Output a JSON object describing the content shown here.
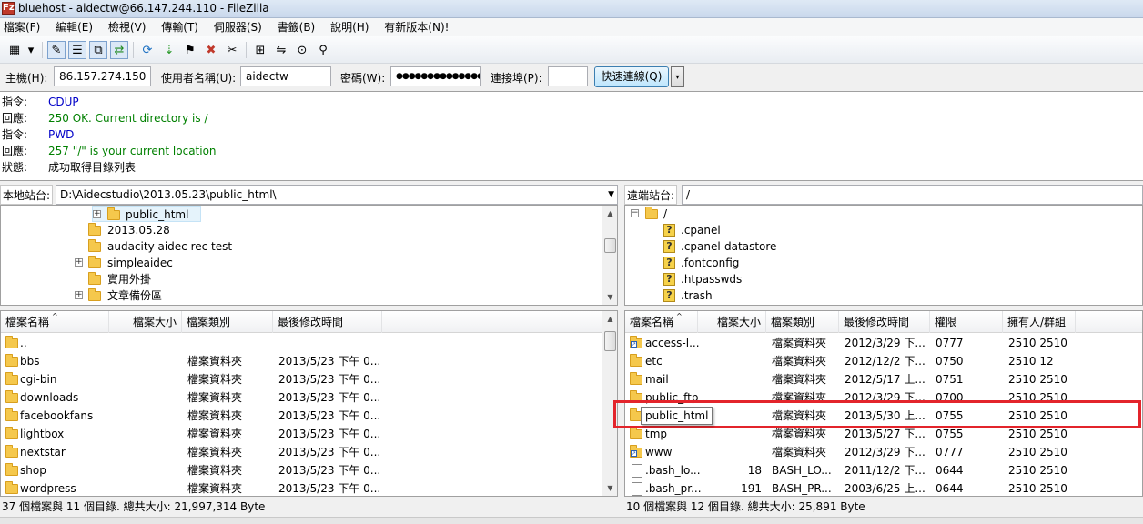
{
  "window": {
    "title": "bluehost - aidectw@66.147.244.110 - FileZilla",
    "app_icon_letter": "Fz"
  },
  "menu": [
    "檔案(F)",
    "編輯(E)",
    "檢視(V)",
    "傳輸(T)",
    "伺服器(S)",
    "書籤(B)",
    "說明(H)",
    "有新版本(N)!"
  ],
  "toolbar": {
    "icons": [
      "site-manager-icon",
      "site-manager-dropdown-icon",
      "toggle-log-icon",
      "toggle-local-tree-icon",
      "toggle-remote-tree-icon",
      "toggle-queue-icon",
      "refresh-icon",
      "process-queue-icon",
      "cancel-icon",
      "disconnect-icon",
      "reconnect-icon",
      "directory-compare-icon",
      "sync-browsing-icon",
      "search-icon",
      "find-files-icon"
    ],
    "glyphs": [
      "▦",
      "▾",
      "✎",
      "☰",
      "⧉",
      "⇄",
      "⟳",
      "⇣",
      "✖",
      "✂",
      "↺",
      "⊞",
      "⇋",
      "⊙",
      "⚲"
    ]
  },
  "quickconnect": {
    "host_label": "主機(H):",
    "host_value": "86.157.274.150",
    "user_label": "使用者名稱(U):",
    "user_value": "aidectw",
    "pass_label": "密碼(W):",
    "pass_value": "●●●●●●●●●●●●●●",
    "port_label": "連接埠(P):",
    "port_value": "",
    "button_label": "快速連線(Q)",
    "dropdown_glyph": "▾"
  },
  "log": [
    {
      "type": "cmd",
      "key": "指令:",
      "value": "CDUP"
    },
    {
      "type": "resp",
      "key": "回應:",
      "value": "250 OK. Current directory is /"
    },
    {
      "type": "cmd",
      "key": "指令:",
      "value": "PWD"
    },
    {
      "type": "resp",
      "key": "回應:",
      "value": "257 \"/\" is your current location"
    },
    {
      "type": "stat",
      "key": "狀態:",
      "value": "成功取得目錄列表"
    }
  ],
  "local": {
    "site_label": "本地站台:",
    "path": "D:\\Aidecstudio\\2013.05.23\\public_html\\",
    "tree": [
      {
        "name": "public_html",
        "expander": "+",
        "indent": 1
      },
      {
        "name": "2013.05.28",
        "expander": "",
        "indent": 0
      },
      {
        "name": "audacity aidec rec test",
        "expander": "",
        "indent": 0
      },
      {
        "name": "simpleaidec",
        "expander": "+",
        "indent": 0
      },
      {
        "name": "實用外掛",
        "expander": "",
        "indent": 0
      },
      {
        "name": "文章備份區",
        "expander": "+",
        "indent": 0
      }
    ],
    "headers": [
      "檔案名稱",
      "檔案大小",
      "檔案類別",
      "最後修改時間"
    ],
    "files": [
      {
        "name": "..",
        "size": "",
        "type": "",
        "modified": ""
      },
      {
        "name": "bbs",
        "size": "",
        "type": "檔案資料夾",
        "modified": "2013/5/23 下午 0..."
      },
      {
        "name": "cgi-bin",
        "size": "",
        "type": "檔案資料夾",
        "modified": "2013/5/23 下午 0..."
      },
      {
        "name": "downloads",
        "size": "",
        "type": "檔案資料夾",
        "modified": "2013/5/23 下午 0..."
      },
      {
        "name": "facebookfans",
        "size": "",
        "type": "檔案資料夾",
        "modified": "2013/5/23 下午 0..."
      },
      {
        "name": "lightbox",
        "size": "",
        "type": "檔案資料夾",
        "modified": "2013/5/23 下午 0..."
      },
      {
        "name": "nextstar",
        "size": "",
        "type": "檔案資料夾",
        "modified": "2013/5/23 下午 0..."
      },
      {
        "name": "shop",
        "size": "",
        "type": "檔案資料夾",
        "modified": "2013/5/23 下午 0..."
      },
      {
        "name": "wordpress",
        "size": "",
        "type": "檔案資料夾",
        "modified": "2013/5/23 下午 0..."
      }
    ],
    "status": "37 個檔案與 11 個目錄. 總共大小: 21,997,314 Byte"
  },
  "remote": {
    "site_label": "遠端站台:",
    "path": "/",
    "tree": [
      {
        "name": "/",
        "icon": "folder",
        "expander": "−"
      },
      {
        "name": ".cpanel",
        "icon": "unknown"
      },
      {
        "name": ".cpanel-datastore",
        "icon": "unknown"
      },
      {
        "name": ".fontconfig",
        "icon": "unknown"
      },
      {
        "name": ".htpasswds",
        "icon": "unknown"
      },
      {
        "name": ".trash",
        "icon": "unknown"
      }
    ],
    "headers": [
      "檔案名稱",
      "檔案大小",
      "檔案類別",
      "最後修改時間",
      "權限",
      "擁有人/群組"
    ],
    "files": [
      {
        "name": "access-l...",
        "icon": "link",
        "size": "",
        "type": "檔案資料夾",
        "modified": "2012/3/29 下...",
        "perms": "0777",
        "owner": "2510 2510"
      },
      {
        "name": "etc",
        "icon": "folder",
        "size": "",
        "type": "檔案資料夾",
        "modified": "2012/12/2 下...",
        "perms": "0750",
        "owner": "2510 12"
      },
      {
        "name": "mail",
        "icon": "folder",
        "size": "",
        "type": "檔案資料夾",
        "modified": "2012/5/17 上...",
        "perms": "0751",
        "owner": "2510 2510"
      },
      {
        "name": "public_ftp",
        "icon": "folder",
        "size": "",
        "type": "檔案資料夾",
        "modified": "2012/3/29 下...",
        "perms": "0700",
        "owner": "2510 2510"
      },
      {
        "name": "public_html",
        "icon": "folder",
        "size": "",
        "type": "檔案資料夾",
        "modified": "2013/5/30 上...",
        "perms": "0755",
        "owner": "2510 2510"
      },
      {
        "name": "tmp",
        "icon": "folder",
        "size": "",
        "type": "檔案資料夾",
        "modified": "2013/5/27 下...",
        "perms": "0755",
        "owner": "2510 2510"
      },
      {
        "name": "www",
        "icon": "link",
        "size": "",
        "type": "檔案資料夾",
        "modified": "2012/3/29 下...",
        "perms": "0777",
        "owner": "2510 2510"
      },
      {
        "name": ".bash_lo...",
        "icon": "file",
        "size": "18",
        "type": "BASH_LO...",
        "modified": "2011/12/2 下...",
        "perms": "0644",
        "owner": "2510 2510"
      },
      {
        "name": ".bash_pr...",
        "icon": "file",
        "size": "191",
        "type": "BASH_PR...",
        "modified": "2003/6/25 上...",
        "perms": "0644",
        "owner": "2510 2510"
      }
    ],
    "tooltip": "public_html",
    "status": "10 個檔案與 12 個目錄. 總共大小: 25,891 Byte"
  },
  "colors": {
    "highlight": "#e3242b",
    "command": "#0000c8",
    "response": "#008000",
    "folder": "#f5c84c"
  }
}
